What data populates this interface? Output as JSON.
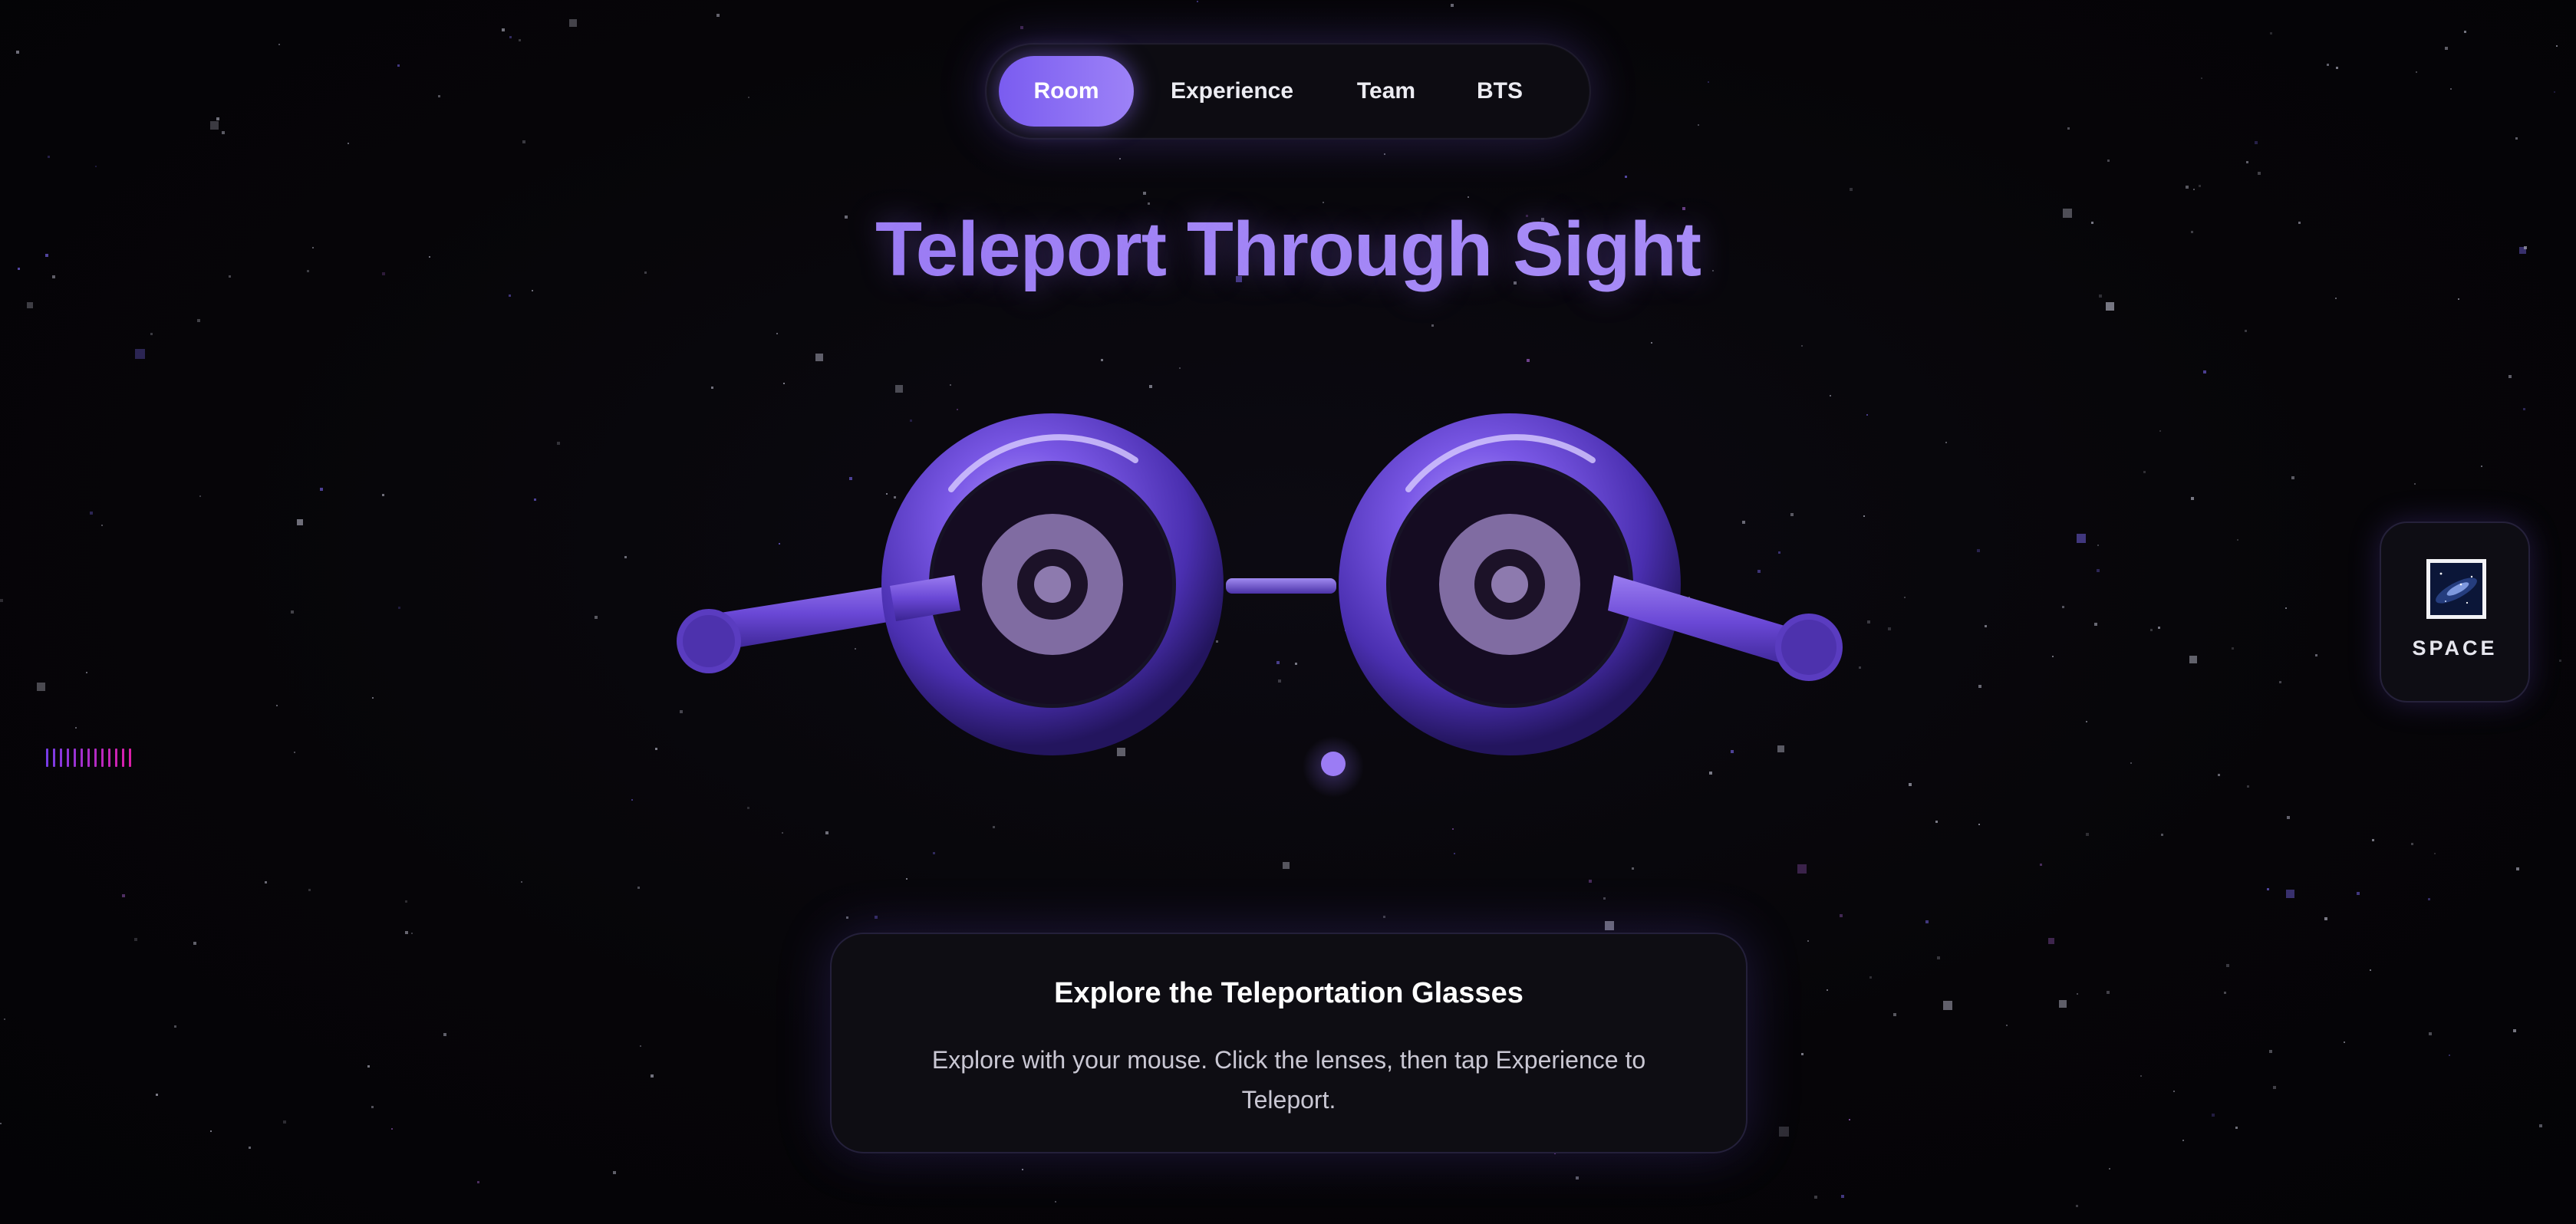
{
  "nav": {
    "items": [
      {
        "label": "Room",
        "active": true
      },
      {
        "label": "Experience",
        "active": false
      },
      {
        "label": "Team",
        "active": false
      },
      {
        "label": "BTS",
        "active": false
      }
    ]
  },
  "hero": {
    "title": "Teleport Through Sight"
  },
  "space_card": {
    "label": "SPACE",
    "icon": "galaxy-thumbnail-icon"
  },
  "panel": {
    "title": "Explore the Teleportation Glasses",
    "body": "Explore with your mouse. Click the lenses, then tap Experience to Teleport."
  },
  "colors": {
    "accent": "#8b6cf0",
    "background": "#060508",
    "frame": "#5b3fc6"
  }
}
